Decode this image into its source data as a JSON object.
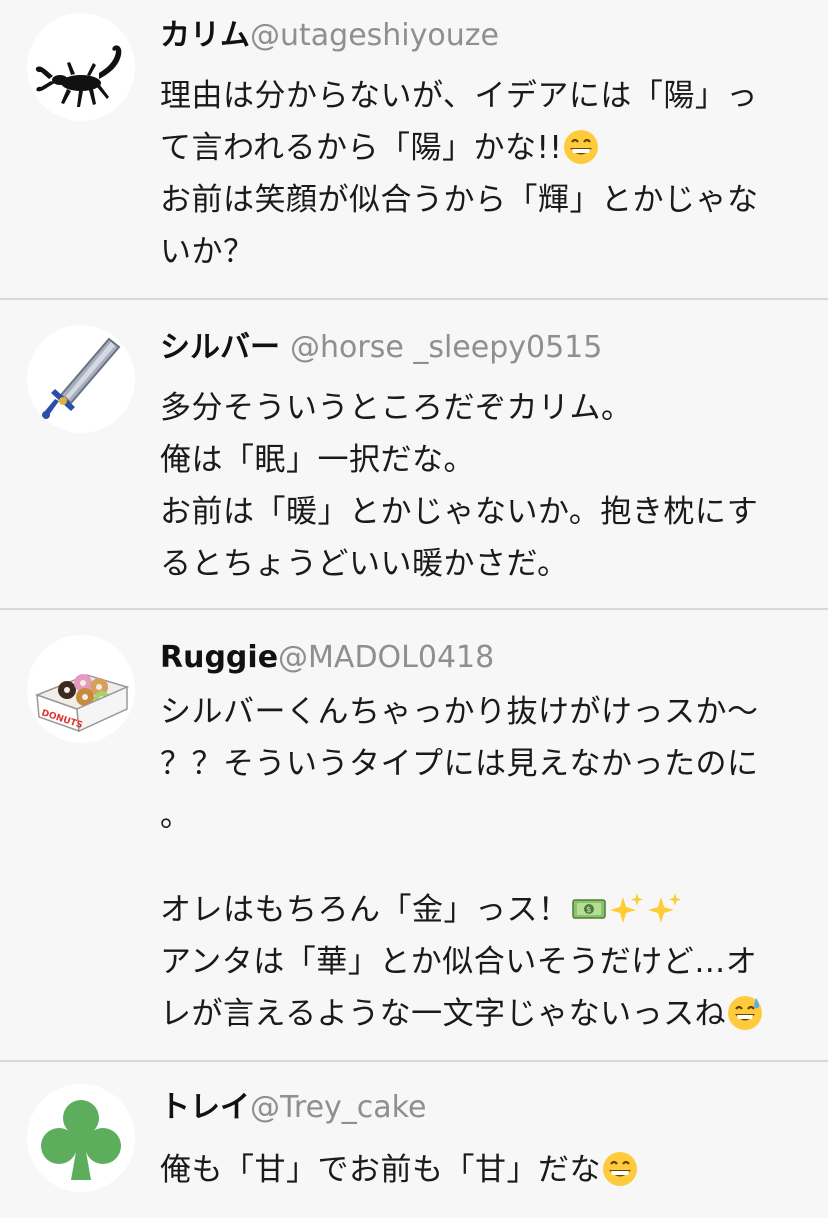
{
  "posts": [
    {
      "name": "カリム",
      "handle": "@utageshiyouze",
      "avatar_icon": "scorpion-icon",
      "lines": [
        {
          "text": "理由は分からないが、イデアには「陽」っ"
        },
        {
          "text": "て言われるから「陽」かな!!",
          "emoji": [
            "grinning-face-icon"
          ]
        },
        {
          "text": "お前は笑顔が似合うから「輝」とかじゃな"
        },
        {
          "text": "いか？"
        }
      ]
    },
    {
      "name": "シルバー",
      "handle": "@horse _sleepy0515",
      "avatar_icon": "sword-icon",
      "lines": [
        {
          "text": "多分そういうところだぞカリム。"
        },
        {
          "text": "俺は「眠」一択だな。"
        },
        {
          "text": "お前は「暖」とかじゃないか。抱き枕にす"
        },
        {
          "text": "るとちょうどいい暖かさだ。"
        }
      ]
    },
    {
      "name": "Ruggie",
      "handle": "@MADOL0418",
      "avatar_icon": "donut-box-icon",
      "avatar_label": "DONUTS",
      "lines": [
        {
          "text": "シルバーくんちゃっかり抜けがけっスか〜"
        },
        {
          "text": "？？そういうタイプには見えなかったのに"
        },
        {
          "text": "。"
        },
        {
          "text": "",
          "blank": true
        },
        {
          "text": "オレはもちろん「金」っス！",
          "emoji": [
            "money-icon",
            "sparkles-icon",
            "sparkles-icon"
          ]
        },
        {
          "text": "アンタは「華」とか似合いそうだけど…オ"
        },
        {
          "text": "レが言えるような一文字じゃないっスね",
          "emoji": [
            "sweat-smile-icon"
          ]
        }
      ]
    },
    {
      "name": "トレイ",
      "handle": "@Trey_cake",
      "avatar_icon": "club-icon",
      "lines": [
        {
          "text": "俺も「甘」でお前も「甘」だな",
          "emoji": [
            "grinning-face-icon"
          ]
        }
      ]
    }
  ],
  "colors": {
    "background": "#f7f7f7",
    "handle": "#8e8e93",
    "divider": "#d9d9d9",
    "club_green": "#5cae5c",
    "sword_blue": "#2a4fa8"
  }
}
